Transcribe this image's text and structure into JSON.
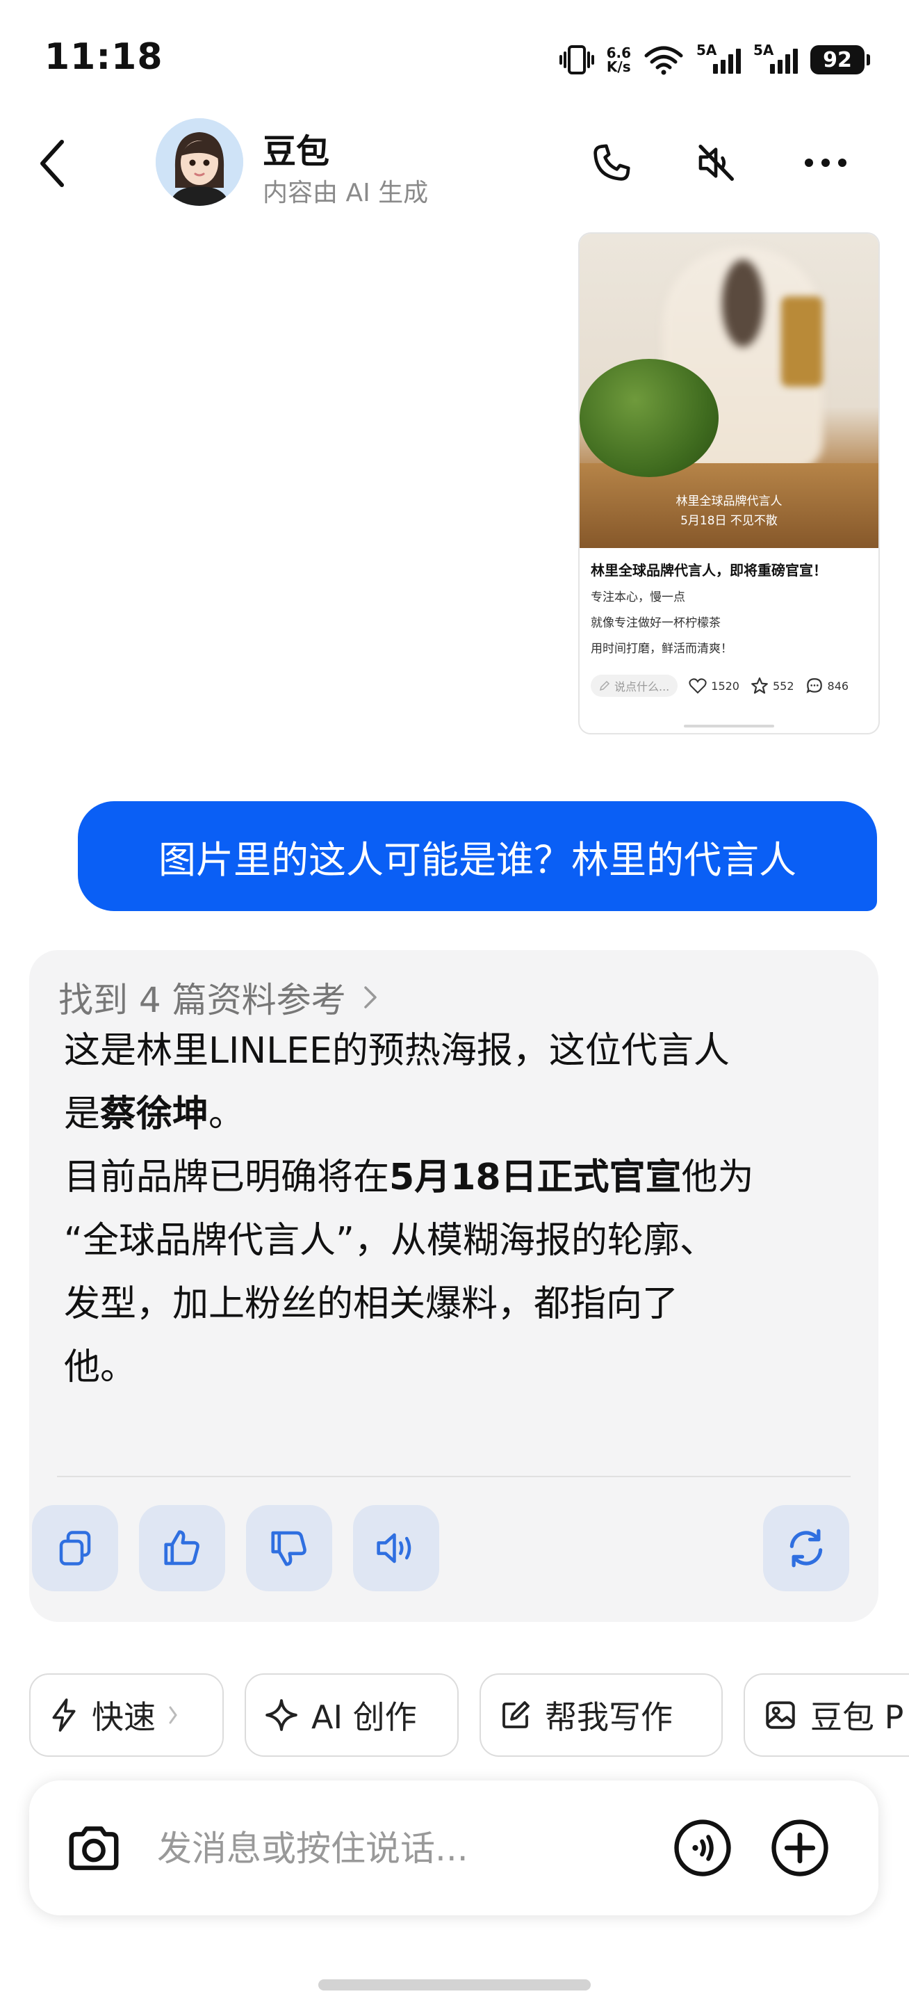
{
  "status_bar": {
    "time": "11:18",
    "net_speed_value": "6.6",
    "net_speed_unit": "K/s",
    "signal1_label": "5A",
    "signal2_label": "5A",
    "battery": "92",
    "icons": [
      "vibrate-icon",
      "wifi-icon",
      "signal-icon",
      "signal-icon",
      "battery-icon"
    ]
  },
  "header": {
    "name": "豆包",
    "subtitle": "内容由 AI 生成",
    "icons": [
      "back-icon",
      "phone-icon",
      "mute-icon",
      "more-icon"
    ]
  },
  "shared_card": {
    "caption1": "林里全球品牌代言人",
    "caption2": "5月18日  不见不散",
    "title": "林里全球品牌代言人，即将重磅官宣！",
    "lines": [
      "专注本心，慢一点",
      "就像专注做好一杯柠檬茶",
      "用时间打磨，鲜活而清爽！"
    ],
    "say_placeholder": "说点什么...",
    "likes": "1520",
    "favorites": "552",
    "comments": "846"
  },
  "user_message": "图片里的这人可能是谁？林里的代言人",
  "ai_response": {
    "refs": "找到 4 篇资料参考",
    "p1_a": "这是林里LINLEE的预热海报，这位代言人",
    "p1_b": "是",
    "p1_bold": "蔡徐坤",
    "p1_c": "。",
    "p2_a": "目前品牌已明确将在",
    "p2_bold": "5月18日正式官宣",
    "p2_b": "他为",
    "p2_c": "“全球品牌代言人”，从模糊海报的轮廓、",
    "p2_d": "发型，加上粉丝的相关爆料，都指向了",
    "p2_e": "他。",
    "feedback_icons": [
      "copy-icon",
      "thumbs-up-icon",
      "thumbs-down-icon",
      "speaker-icon",
      "regenerate-icon"
    ]
  },
  "quick_chips": [
    {
      "icon": "lightning-icon",
      "label": "快速"
    },
    {
      "icon": "sparkle-icon",
      "label": "AI 创作"
    },
    {
      "icon": "edit-icon",
      "label": "帮我写作"
    },
    {
      "icon": "image-icon",
      "label": "豆包 P"
    }
  ],
  "input": {
    "placeholder": "发消息或按住说话..."
  },
  "colors": {
    "accent": "#0A5FF5",
    "bubble_text": "#FFFFFF",
    "ai_bg": "#F4F4F5",
    "feedback_btn_bg": "#DFE6F3",
    "icon_blue": "#2F6FE0"
  }
}
